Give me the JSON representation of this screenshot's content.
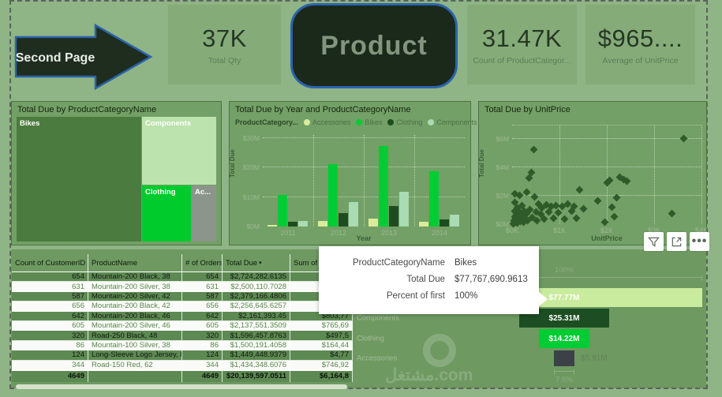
{
  "header": {
    "back_arrow_label": "Second Page",
    "product_button_label": "Product",
    "kpis": [
      {
        "value": "37K",
        "label": "Total Qty"
      },
      {
        "value": "31.47K",
        "label": "Count of ProductCategor..."
      },
      {
        "value": "$965....",
        "label": "Average of UnitPrice"
      }
    ]
  },
  "treemap": {
    "title": "Total Due by ProductCategoryName",
    "items": [
      {
        "name": "Bikes",
        "color": "#4C7B40"
      },
      {
        "name": "Components",
        "color": "#BCE2AE"
      },
      {
        "name": "Clothing",
        "color": "#00CB2C"
      },
      {
        "name": "Ac...",
        "color": "#8C958C"
      }
    ]
  },
  "bar_chart": {
    "title": "Total Due by Year and ProductCategoryName",
    "legend_title": "ProductCategory...",
    "legend": [
      {
        "name": "Accessories",
        "color": "#D9EC9C"
      },
      {
        "name": "Bikes",
        "color": "#00CC33"
      },
      {
        "name": "Clothing",
        "color": "#1D4D1F"
      },
      {
        "name": "Components",
        "color": "#A9DBB4"
      }
    ],
    "ylabel": "Total Due",
    "xlabel": "Year",
    "yticks": [
      "$0M",
      "$10M",
      "$20M",
      "$30M"
    ],
    "xticks": [
      "2011",
      "2012",
      "2013",
      "2014"
    ]
  },
  "scatter": {
    "title": "Total Due by UnitPrice",
    "ylabel": "Total Due",
    "xlabel": "UnitPrice",
    "yticks": [
      "$0M",
      "$2M",
      "$4M",
      "$6M"
    ],
    "xticks": [
      "$0K",
      "$1K",
      "$2K",
      "$3K",
      "$4K"
    ]
  },
  "table": {
    "columns": [
      "Count of CustomerID",
      "ProductName",
      "# of Orders",
      "Total Due",
      "Sum of"
    ],
    "sort_column": "Total Due",
    "sort_indicator": "▾",
    "rows": [
      {
        "customer_count": "654",
        "product": "Mountain-200 Black, 38",
        "orders": "654",
        "total_due": "$2,724,282.6135",
        "sum_of": ""
      },
      {
        "customer_count": "631",
        "product": "Mountain-200 Silver, 38",
        "orders": "631",
        "total_due": "$2,500,110.7028",
        "sum_of": ""
      },
      {
        "customer_count": "587",
        "product": "Mountain-200 Silver, 42",
        "orders": "587",
        "total_due": "$2,379,166.4806",
        "sum_of": ""
      },
      {
        "customer_count": "656",
        "product": "Mountain-200 Black, 42",
        "orders": "656",
        "total_due": "$2,256,645.6257",
        "sum_of": ""
      },
      {
        "customer_count": "642",
        "product": "Mountain-200 Black, 46",
        "orders": "642",
        "total_due": "$2,161,393.45",
        "sum_of": "$803,77"
      },
      {
        "customer_count": "605",
        "product": "Mountain-200 Silver, 46",
        "orders": "605",
        "total_due": "$2,137,551.3509",
        "sum_of": "$765,69"
      },
      {
        "customer_count": "320",
        "product": "Road-250 Black, 48",
        "orders": "320",
        "total_due": "$1,596,457.8763",
        "sum_of": "$497,5"
      },
      {
        "customer_count": "86",
        "product": "Mountain-100 Silver, 38",
        "orders": "86",
        "total_due": "$1,500,191.4058",
        "sum_of": "$164,44"
      },
      {
        "customer_count": "124",
        "product": "Long-Sleeve Logo Jersey, L",
        "orders": "124",
        "total_due": "$1,449,448.9379",
        "sum_of": "$4,77"
      },
      {
        "customer_count": "344",
        "product": "Road-150 Red, 62",
        "orders": "344",
        "total_due": "$1,434,348.6076",
        "sum_of": "$746,92"
      }
    ],
    "total": {
      "customer_count": "4649",
      "product": "",
      "orders": "4649",
      "total_due": "$20,139,597.0511",
      "sum_of": "$6,164,8"
    }
  },
  "tooltip": {
    "rows": [
      {
        "label": "ProductCategoryName",
        "value": "Bikes"
      },
      {
        "label": "Total Due",
        "value": "$77,767,690.9613"
      },
      {
        "label": "Percent of first",
        "value": "100%"
      }
    ]
  },
  "funnel": {
    "top_percent": "100%",
    "bottom_percent": "7.6%",
    "bars": [
      {
        "name": "Bikes",
        "value_label": "$77.77M",
        "value": 77.77,
        "color": "#C9EB9E",
        "label_inside": true,
        "dotted": false
      },
      {
        "name": "Components",
        "value_label": "$25.31M",
        "value": 25.31,
        "color": "#1D4D22",
        "label_inside": true,
        "dotted": false
      },
      {
        "name": "Clothing",
        "value_label": "$14.22M",
        "value": 14.22,
        "color": "#00CC33",
        "label_inside": true,
        "dotted": false
      },
      {
        "name": "Accessories",
        "value_label": "$5.91M",
        "value": 5.91,
        "color": "#3C4148",
        "label_inside": false,
        "dotted": true
      }
    ]
  },
  "watermark": "مشتغل.com",
  "colors": {
    "page_bg": "#8FB485",
    "card_bg": "#85AC78",
    "panel_bg": "#73A066",
    "band_bg": "#6E9961",
    "row_green": "#5D8A52",
    "accent_blue": "#2B63AC",
    "bright_green": "#00CC33",
    "dark_green": "#1D4D1F"
  },
  "chart_data": [
    {
      "type": "bar",
      "title": "Total Due by Year and ProductCategoryName",
      "xlabel": "Year",
      "ylabel": "Total Due",
      "categories": [
        "2011",
        "2012",
        "2013",
        "2014"
      ],
      "series": [
        {
          "name": "Accessories",
          "values": [
            0.6,
            1.8,
            2.8,
            1.5
          ]
        },
        {
          "name": "Bikes",
          "values": [
            10.8,
            21.2,
            27.3,
            18.7
          ]
        },
        {
          "name": "Clothing",
          "values": [
            1.7,
            4.5,
            6.9,
            2.3
          ]
        },
        {
          "name": "Components",
          "values": [
            1.9,
            8.3,
            11.9,
            4.1
          ]
        }
      ],
      "value_unit": "$M",
      "ylim": [
        0,
        31
      ],
      "grid": true,
      "legend_position": "top"
    },
    {
      "type": "scatter",
      "title": "Total Due by UnitPrice",
      "xlabel": "UnitPrice",
      "ylabel": "Total Due",
      "x_unit": "$K",
      "y_unit": "$M",
      "xlim": [
        0,
        4
      ],
      "ylim": [
        0,
        7
      ],
      "grid": true,
      "points": [
        [
          0.03,
          0.1
        ],
        [
          0.04,
          0.3
        ],
        [
          0.05,
          0.6
        ],
        [
          0.05,
          1.0
        ],
        [
          0.06,
          1.6
        ],
        [
          0.06,
          2.2
        ],
        [
          0.07,
          0.2
        ],
        [
          0.08,
          0.45
        ],
        [
          0.09,
          0.8
        ],
        [
          0.1,
          0.15
        ],
        [
          0.1,
          1.2
        ],
        [
          0.12,
          0.35
        ],
        [
          0.13,
          0.6
        ],
        [
          0.15,
          2.1
        ],
        [
          0.15,
          0.9
        ],
        [
          0.17,
          0.25
        ],
        [
          0.18,
          0.5
        ],
        [
          0.2,
          1.35
        ],
        [
          0.22,
          0.7
        ],
        [
          0.24,
          0.2
        ],
        [
          0.25,
          1.0
        ],
        [
          0.28,
          0.45
        ],
        [
          0.3,
          2.3
        ],
        [
          0.3,
          0.8
        ],
        [
          0.33,
          0.3
        ],
        [
          0.35,
          3.3
        ],
        [
          0.38,
          1.1
        ],
        [
          0.4,
          3.7
        ],
        [
          0.42,
          0.55
        ],
        [
          0.45,
          5.3
        ],
        [
          0.47,
          2.0
        ],
        [
          0.5,
          0.9
        ],
        [
          0.52,
          0.3
        ],
        [
          0.55,
          1.5
        ],
        [
          0.6,
          0.75
        ],
        [
          0.63,
          1.2
        ],
        [
          0.68,
          0.4
        ],
        [
          0.72,
          1.4
        ],
        [
          0.78,
          0.9
        ],
        [
          0.82,
          1.3
        ],
        [
          0.88,
          0.5
        ],
        [
          0.92,
          1.35
        ],
        [
          0.98,
          0.85
        ],
        [
          1.05,
          1.3
        ],
        [
          1.1,
          0.4
        ],
        [
          1.18,
          1.45
        ],
        [
          1.25,
          0.95
        ],
        [
          1.3,
          1.3
        ],
        [
          1.35,
          0.5
        ],
        [
          1.42,
          2.5
        ],
        [
          1.5,
          1.15
        ],
        [
          1.8,
          1.7
        ],
        [
          1.95,
          0.2
        ],
        [
          2.0,
          3.0
        ],
        [
          2.05,
          3.15
        ],
        [
          2.1,
          1.25
        ],
        [
          2.15,
          0.6
        ],
        [
          2.2,
          1.9
        ],
        [
          2.28,
          3.35
        ],
        [
          2.35,
          3.2
        ],
        [
          2.42,
          3.1
        ],
        [
          3.38,
          0.8
        ],
        [
          3.62,
          6.1
        ]
      ]
    },
    {
      "type": "pie",
      "title": "Total Due by ProductCategoryName",
      "categories": [
        "Bikes",
        "Components",
        "Clothing",
        "Accessories"
      ],
      "values": [
        77.77,
        25.31,
        14.22,
        5.91
      ],
      "value_unit": "$M",
      "note": "rendered as treemap"
    },
    {
      "type": "bar",
      "title": "Funnel: Total Due by ProductCategoryName",
      "categories": [
        "Bikes",
        "Components",
        "Clothing",
        "Accessories"
      ],
      "values": [
        77.77,
        25.31,
        14.22,
        5.91
      ],
      "value_unit": "$M",
      "annotations": [
        "100%",
        "7.6%"
      ]
    }
  ]
}
